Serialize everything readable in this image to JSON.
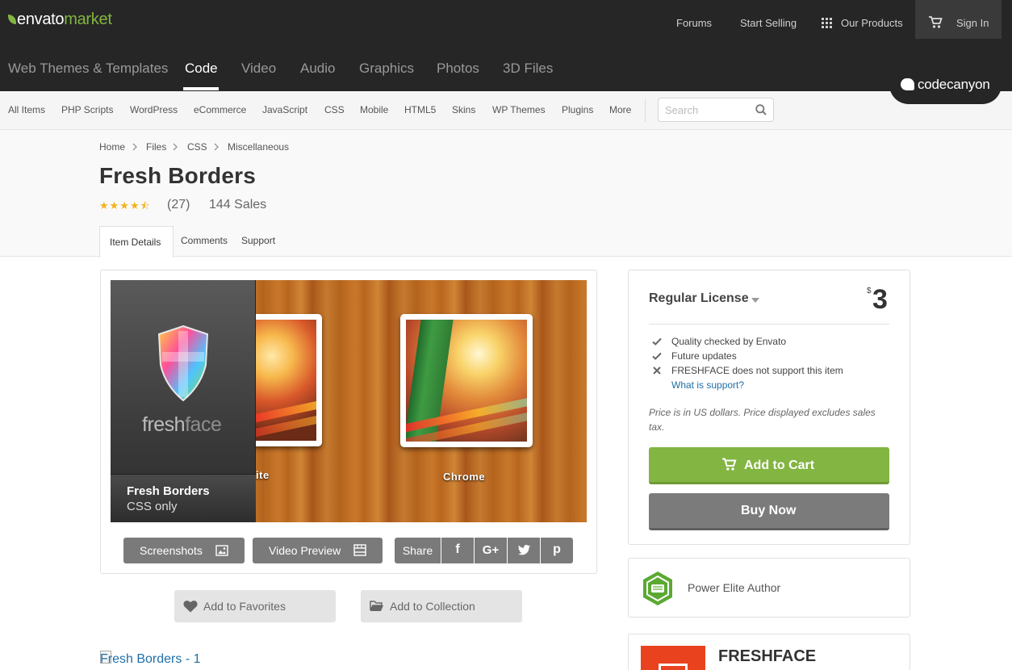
{
  "brand": {
    "name_part1": "envato",
    "name_part2": "market",
    "accent": "#82b541"
  },
  "topnav": {
    "forums": "Forums",
    "start_selling": "Start Selling",
    "our_products": "Our Products",
    "sign_in": "Sign In"
  },
  "categories": [
    {
      "label": "Web Themes & Templates",
      "active": false
    },
    {
      "label": "Code",
      "active": true
    },
    {
      "label": "Video",
      "active": false
    },
    {
      "label": "Audio",
      "active": false
    },
    {
      "label": "Graphics",
      "active": false
    },
    {
      "label": "Photos",
      "active": false
    },
    {
      "label": "3D Files",
      "active": false
    }
  ],
  "marketplace_badge": "codecanyon",
  "subnav": {
    "items": [
      "All Items",
      "PHP Scripts",
      "WordPress",
      "eCommerce",
      "JavaScript",
      "CSS",
      "Mobile",
      "HTML5",
      "Skins",
      "WP Themes",
      "Plugins",
      "More"
    ],
    "search_placeholder": "Search"
  },
  "breadcrumb": [
    "Home",
    "Files",
    "CSS",
    "Miscellaneous"
  ],
  "item": {
    "title": "Fresh Borders",
    "rating_stars": "★★★★⯪",
    "rating_value": 4.5,
    "rating_count": "(27)",
    "sales": "144 Sales"
  },
  "tabs": [
    "Item Details",
    "Comments",
    "Support"
  ],
  "preview": {
    "logo_part1": "fresh",
    "logo_part2": "face",
    "panel_title": "Fresh Borders",
    "panel_subtitle": "CSS only",
    "label_left": "ite",
    "label_right": "Chrome"
  },
  "preview_actions": {
    "screenshots": "Screenshots",
    "video_preview": "Video Preview",
    "share": "Share",
    "social": [
      "f",
      "G+",
      "t",
      "p"
    ]
  },
  "actions": {
    "favorites": "Add to Favorites",
    "collection": "Add to Collection"
  },
  "image_alt": "Fresh Borders - 1",
  "license": {
    "title": "Regular License",
    "currency": "$",
    "price": "3",
    "features": [
      {
        "icon": "check-icon",
        "text": "Quality checked by Envato"
      },
      {
        "icon": "check-icon",
        "text": "Future updates"
      },
      {
        "icon": "cross-icon",
        "text": "FRESHFACE does not support this item"
      }
    ],
    "support_link": "What is support?",
    "price_note": "Price is in US dollars. Price displayed excludes sales tax.",
    "add_to_cart": "Add to Cart",
    "buy_now": "Buy Now"
  },
  "author": {
    "badge_label": "Power Elite Author",
    "name": "FRESHFACE",
    "badge_color": "#5ba932",
    "avatar_color": "#e8421f"
  }
}
